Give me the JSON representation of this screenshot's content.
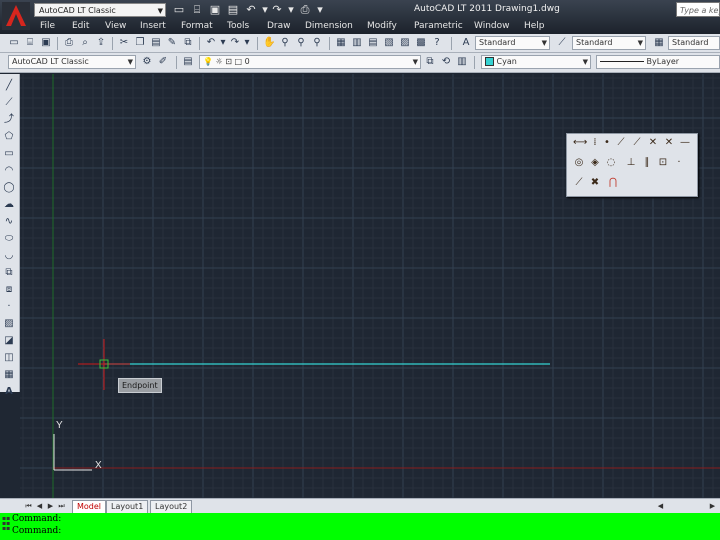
{
  "titlebar": {
    "workspace": "AutoCAD LT Classic",
    "title": "AutoCAD LT 2011    Drawing1.dwg",
    "search_placeholder": "Type a keyw"
  },
  "menu": [
    "File",
    "Edit",
    "View",
    "Insert",
    "Format",
    "Tools",
    "Draw",
    "Dimension",
    "Modify",
    "Parametric",
    "Window",
    "Help"
  ],
  "toolbar1": {
    "text_style": "Standard",
    "dim_style": "Standard",
    "table_style": "Standard"
  },
  "toolbar2": {
    "workspace": "AutoCAD LT Classic",
    "layer": "0",
    "color": "Cyan",
    "linetype": "ByLayer"
  },
  "canvas": {
    "tooltip": "Endpoint",
    "ucs_x": "X",
    "ucs_y": "Y"
  },
  "layout_tabs": [
    "Model",
    "Layout1",
    "Layout2"
  ],
  "command_lines": [
    "Command:",
    "Command:"
  ],
  "colors": {
    "background": "#1f2733",
    "grid_minor": "#28313e",
    "grid_major": "#334050",
    "line": "#35d2d2",
    "cursor": "#cc1a1a",
    "axis_x": "#8a1c1c",
    "axis_y": "#1f6b2a",
    "command_bg": "#00ff00"
  }
}
